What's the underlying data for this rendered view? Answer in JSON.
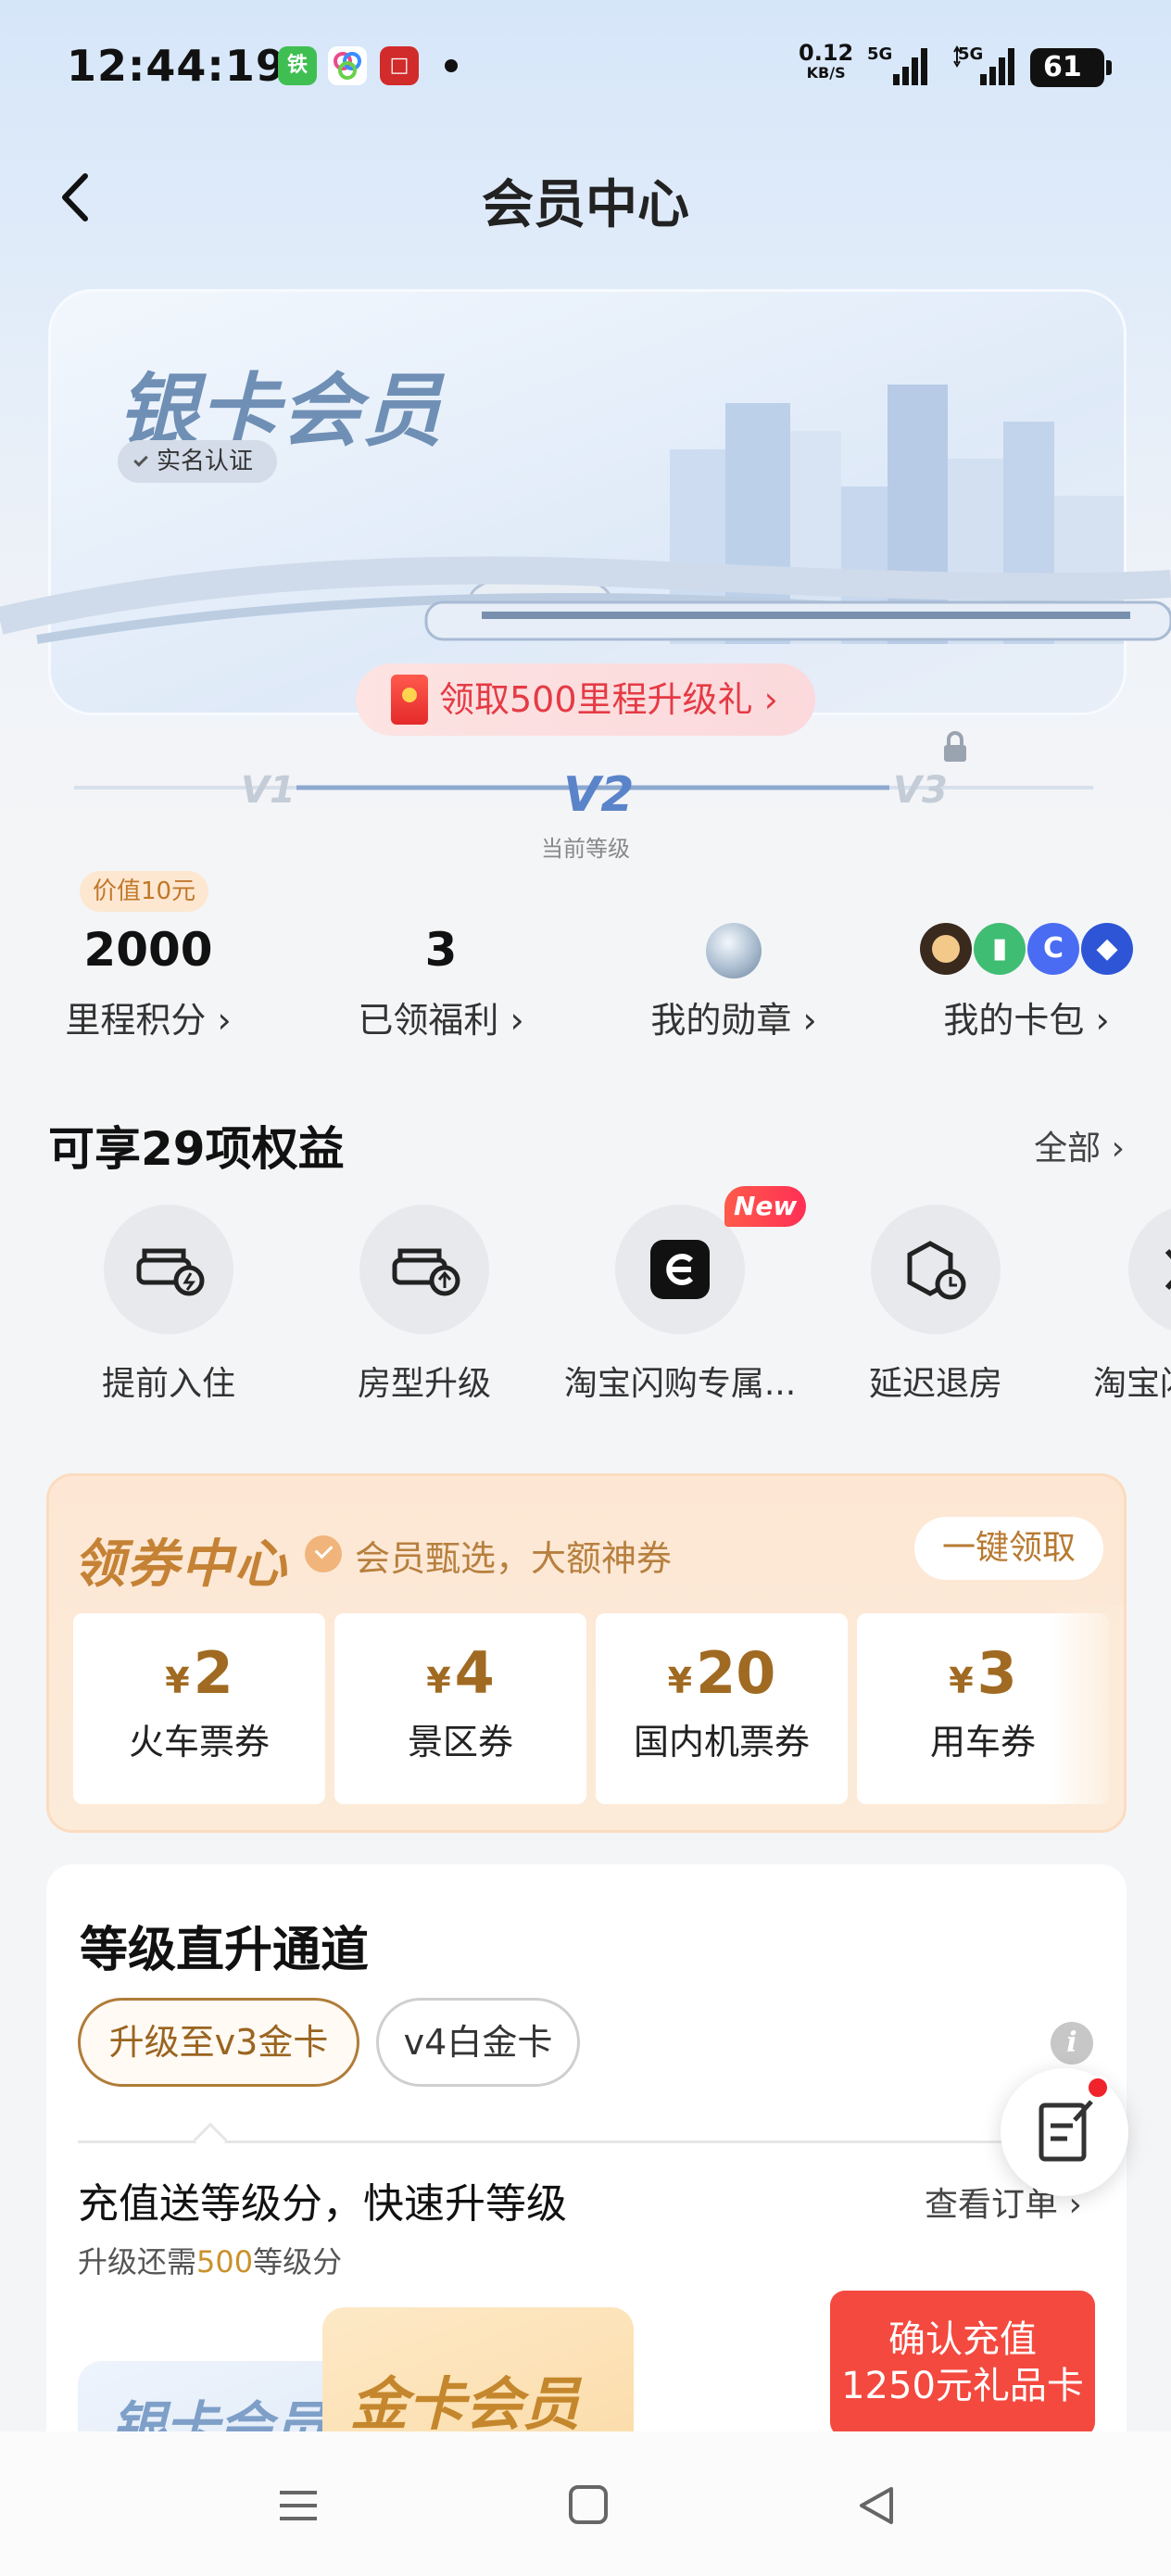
{
  "status_bar": {
    "time": "12:44:19",
    "net_speed": "0.12",
    "net_unit": "KB/S",
    "signal1": "5G",
    "signal2": "5G",
    "battery": "61",
    "apps": [
      {
        "icon": "railway-app-icon",
        "color": "#3fbf52",
        "text": "铁"
      },
      {
        "icon": "colorful-app-icon",
        "color": "#ffffff",
        "text": ""
      },
      {
        "icon": "red-app-icon",
        "color": "#d12b2b",
        "text": "□"
      }
    ]
  },
  "nav": {
    "title": "会员中心",
    "back_icon": "back-arrow-icon"
  },
  "member_card": {
    "level_name": "银卡会员",
    "verify_label": "实名认证"
  },
  "upgrade_gift": {
    "label": "领取500里程升级礼 ›"
  },
  "levels": {
    "v1": "V1",
    "v2": "V2",
    "v3": "V3",
    "current_label": "当前等级",
    "current": "V2"
  },
  "stats": {
    "value_tag": "价值10元",
    "items": [
      {
        "value": "2000",
        "label": "里程积分 ›"
      },
      {
        "value": "3",
        "label": "已领福利 ›"
      },
      {
        "label": "我的勋章 ›",
        "icon": "medal-icon"
      },
      {
        "label": "我的卡包 ›",
        "icon": "card-pack-icons"
      }
    ]
  },
  "benefits": {
    "title": "可享29项权益",
    "all_label": "全部 ›",
    "new_badge": "New",
    "items": [
      {
        "label": "提前入住",
        "icon": "early-checkin-icon"
      },
      {
        "label": "房型升级",
        "icon": "room-upgrade-icon"
      },
      {
        "label": "淘宝闪购专属...",
        "icon": "taobao-flash-icon"
      },
      {
        "label": "延迟退房",
        "icon": "late-checkout-icon"
      },
      {
        "label": "淘宝闪",
        "icon": "taobao-icon"
      }
    ]
  },
  "coupon_center": {
    "title": "领券中心",
    "subtitle": "会员甄选，大额神券",
    "claim_all": "一键领取",
    "currency": "¥",
    "coupons": [
      {
        "amount": "2",
        "name": "火车票券"
      },
      {
        "amount": "4",
        "name": "景区券"
      },
      {
        "amount": "20",
        "name": "国内机票券"
      },
      {
        "amount": "3",
        "name": "用车券"
      }
    ]
  },
  "upgrade_channel": {
    "title": "等级直升通道",
    "tabs": [
      "升级至v3金卡",
      "v4白金卡"
    ],
    "active_tab": "升级至v3金卡",
    "info_icon": "i",
    "subtitle": "充值送等级分，快速升等级",
    "view_orders": "查看订单 ›",
    "need_prefix": "升级还需",
    "need_value": "500",
    "need_suffix": "等级分",
    "silver_card": "银卡会员",
    "gold_card": "金卡会员",
    "confirm_line1": "确认充值",
    "confirm_line2": "1250元礼品卡"
  },
  "colors": {
    "accent_red": "#f4493f",
    "gold": "#c58235",
    "silver_blue": "#6f8fb5",
    "level_blue": "#5a84c9"
  }
}
